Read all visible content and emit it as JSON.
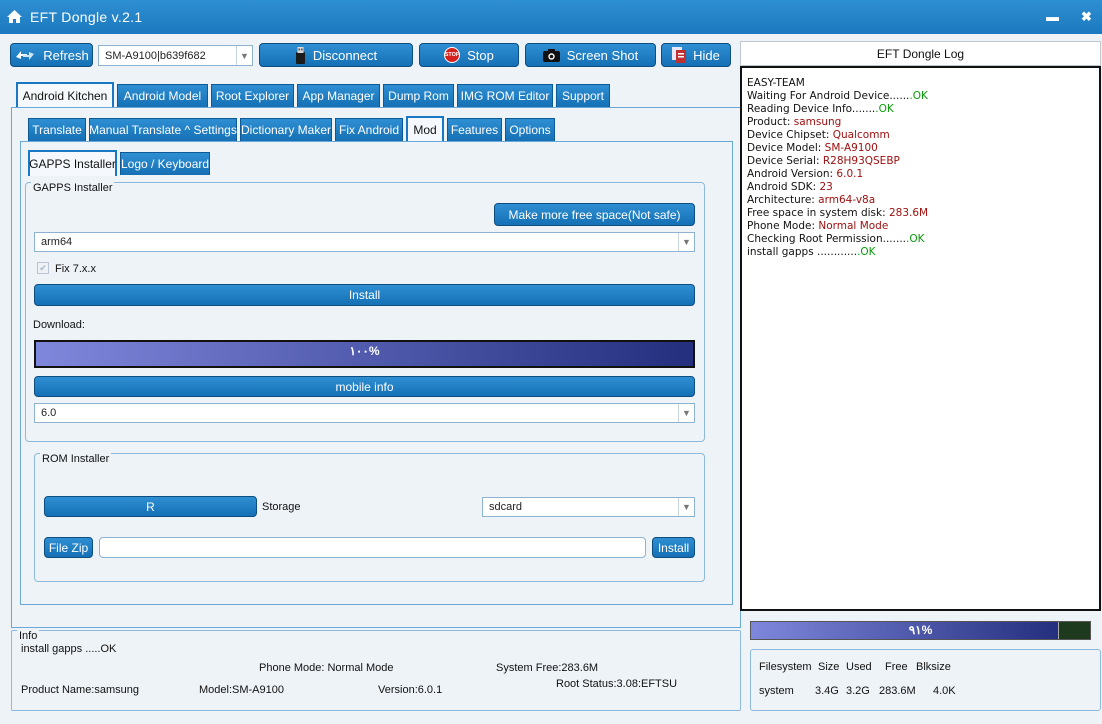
{
  "window": {
    "title": "EFT Dongle  v.2.1",
    "minimize_glyph": "▬",
    "close_glyph": "✖"
  },
  "toolbar": {
    "refresh_label": "Refresh",
    "device_selected": "SM-A9100|b639f682",
    "disconnect_label": "Disconnect",
    "stop_label": "Stop",
    "stop_badge": "STOP",
    "screenshot_label": "Screen Shot",
    "hide_label": "Hide"
  },
  "main_tabs": [
    "Android Kitchen",
    "Android Model",
    "Root Explorer",
    "App Manager",
    "Dump Rom",
    "IMG ROM Editor",
    "Support"
  ],
  "sub_tabs": [
    "Translate",
    "Manual Translate ^ Settings",
    "Dictionary Maker",
    "Fix Android",
    "Mod",
    "Features",
    "Options"
  ],
  "mod_tabs": [
    "GAPPS Installer",
    "Logo / Keyboard"
  ],
  "gapps": {
    "group_label": "GAPPS Installer",
    "free_space_button": "Make more free space(Not safe)",
    "arch_selected": "arm64",
    "fix_checkbox_label": "Fix 7.x.x",
    "install_button": "Install",
    "download_label": "Download:",
    "download_progress_text": "۱۰۰%",
    "download_progress": 100,
    "mobile_info_button": "mobile info",
    "version_selected": "6.0"
  },
  "rom": {
    "group_label": "ROM Installer",
    "r_button": "R",
    "storage_label": "Storage",
    "storage_selected": "sdcard",
    "file_zip_button": "File Zip",
    "path_value": "",
    "install_button": "Install"
  },
  "info": {
    "title": "Info",
    "status": "install gapps .....OK",
    "phone_mode": "Phone Mode: Normal Mode",
    "system_free": "System Free:283.6M",
    "product_name": "Product Name:samsung",
    "model": "Model:SM-A9100",
    "version": "Version:6.0.1",
    "root_status": "Root Status:3.08:EFTSU"
  },
  "log": {
    "header": "EFT Dongle Log",
    "lines": [
      {
        "k": "EASY-TEAM",
        "v": "",
        "c": ""
      },
      {
        "k": "Waiting For Android Device......",
        "v": ".OK",
        "c": "ok"
      },
      {
        "k": "Reading Device Info.......",
        "v": ".OK",
        "c": "ok"
      },
      {
        "k": "Product: ",
        "v": "samsung",
        "c": "red"
      },
      {
        "k": "Device Chipset: ",
        "v": "Qualcomm",
        "c": "red"
      },
      {
        "k": "Device Model: ",
        "v": "SM-A9100",
        "c": "red"
      },
      {
        "k": "Device Serial: ",
        "v": "R28H93QSEBP",
        "c": "red"
      },
      {
        "k": "Android Version: ",
        "v": "6.0.1",
        "c": "red"
      },
      {
        "k": "Android SDK: ",
        "v": "23",
        "c": "red"
      },
      {
        "k": "Architecture: ",
        "v": "arm64-v8a",
        "c": "red"
      },
      {
        "k": "Free space in system disk: ",
        "v": "283.6M",
        "c": "red"
      },
      {
        "k": "Phone Mode: ",
        "v": "Normal Mode",
        "c": "red"
      },
      {
        "k": "Checking Root Permission.......",
        "v": ".OK",
        "c": "ok"
      },
      {
        "k": "install gapps ............",
        "v": ".OK",
        "c": "ok"
      }
    ]
  },
  "disk": {
    "progress_text": "۹۱%",
    "progress": 91,
    "headers": [
      "Filesystem",
      "Size",
      "Used",
      "Free",
      "Blksize"
    ],
    "row": [
      "system",
      "3.4G",
      "3.2G",
      "283.6M",
      "4.0K"
    ]
  },
  "colors": {
    "accent": "#1a78c2",
    "ok": "#0a9a0a",
    "value_red": "#a01010",
    "progress_start": "#7f87dc",
    "progress_end": "#242f7e"
  }
}
